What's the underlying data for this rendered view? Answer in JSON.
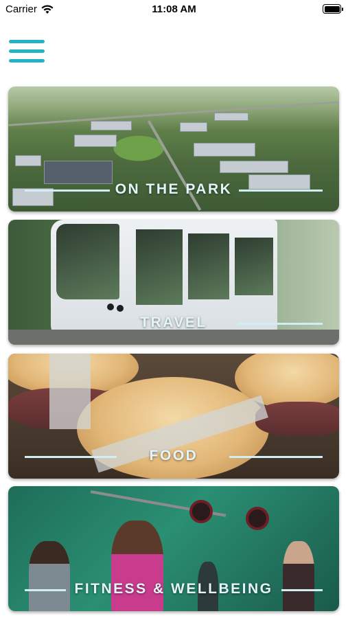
{
  "status_bar": {
    "carrier": "Carrier",
    "time": "11:08 AM",
    "wifi_icon": "wifi-icon",
    "battery_icon": "battery-icon"
  },
  "menu": {
    "icon": "hamburger-menu-icon",
    "color": "#22b3c9"
  },
  "cards": [
    {
      "title": "ON THE PARK"
    },
    {
      "title": "TRAVEL"
    },
    {
      "title": "FOOD"
    },
    {
      "title": "FITNESS & WELLBEING"
    }
  ],
  "colors": {
    "label_line": "#d2eef5",
    "label_text": "#e4f5fa"
  }
}
